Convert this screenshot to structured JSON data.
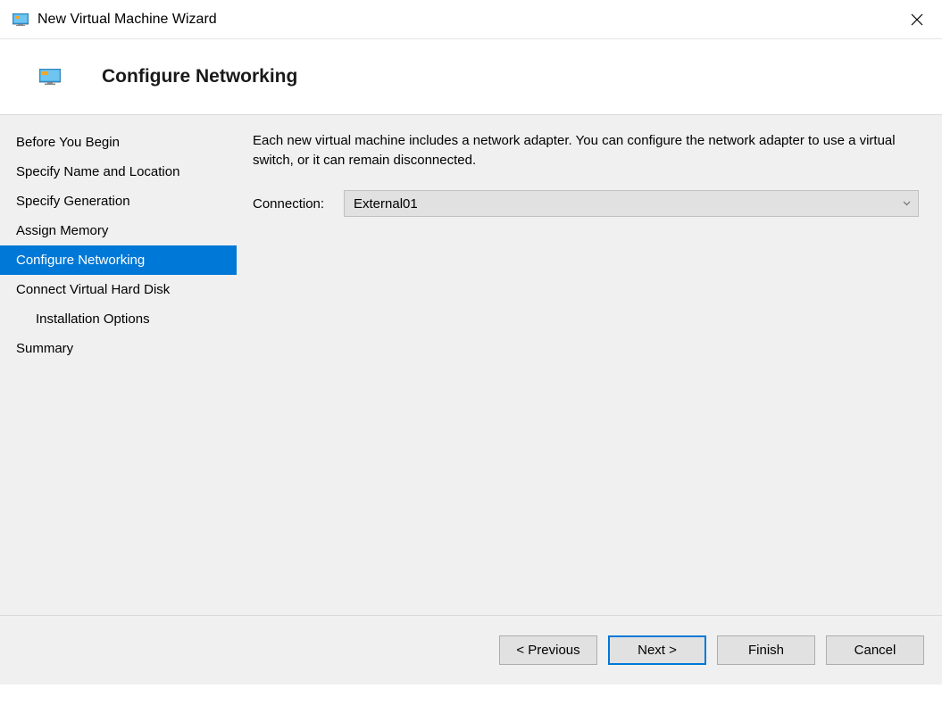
{
  "titlebar": {
    "title": "New Virtual Machine Wizard"
  },
  "header": {
    "title": "Configure Networking"
  },
  "sidebar": {
    "items": [
      {
        "label": "Before You Begin",
        "selected": false,
        "indent": false
      },
      {
        "label": "Specify Name and Location",
        "selected": false,
        "indent": false
      },
      {
        "label": "Specify Generation",
        "selected": false,
        "indent": false
      },
      {
        "label": "Assign Memory",
        "selected": false,
        "indent": false
      },
      {
        "label": "Configure Networking",
        "selected": true,
        "indent": false
      },
      {
        "label": "Connect Virtual Hard Disk",
        "selected": false,
        "indent": false
      },
      {
        "label": "Installation Options",
        "selected": false,
        "indent": true
      },
      {
        "label": "Summary",
        "selected": false,
        "indent": false
      }
    ]
  },
  "content": {
    "description": "Each new virtual machine includes a network adapter. You can configure the network adapter to use a virtual switch, or it can remain disconnected.",
    "connection_label": "Connection:",
    "connection_value": "External01"
  },
  "footer": {
    "previous": "< Previous",
    "next": "Next >",
    "finish": "Finish",
    "cancel": "Cancel"
  }
}
